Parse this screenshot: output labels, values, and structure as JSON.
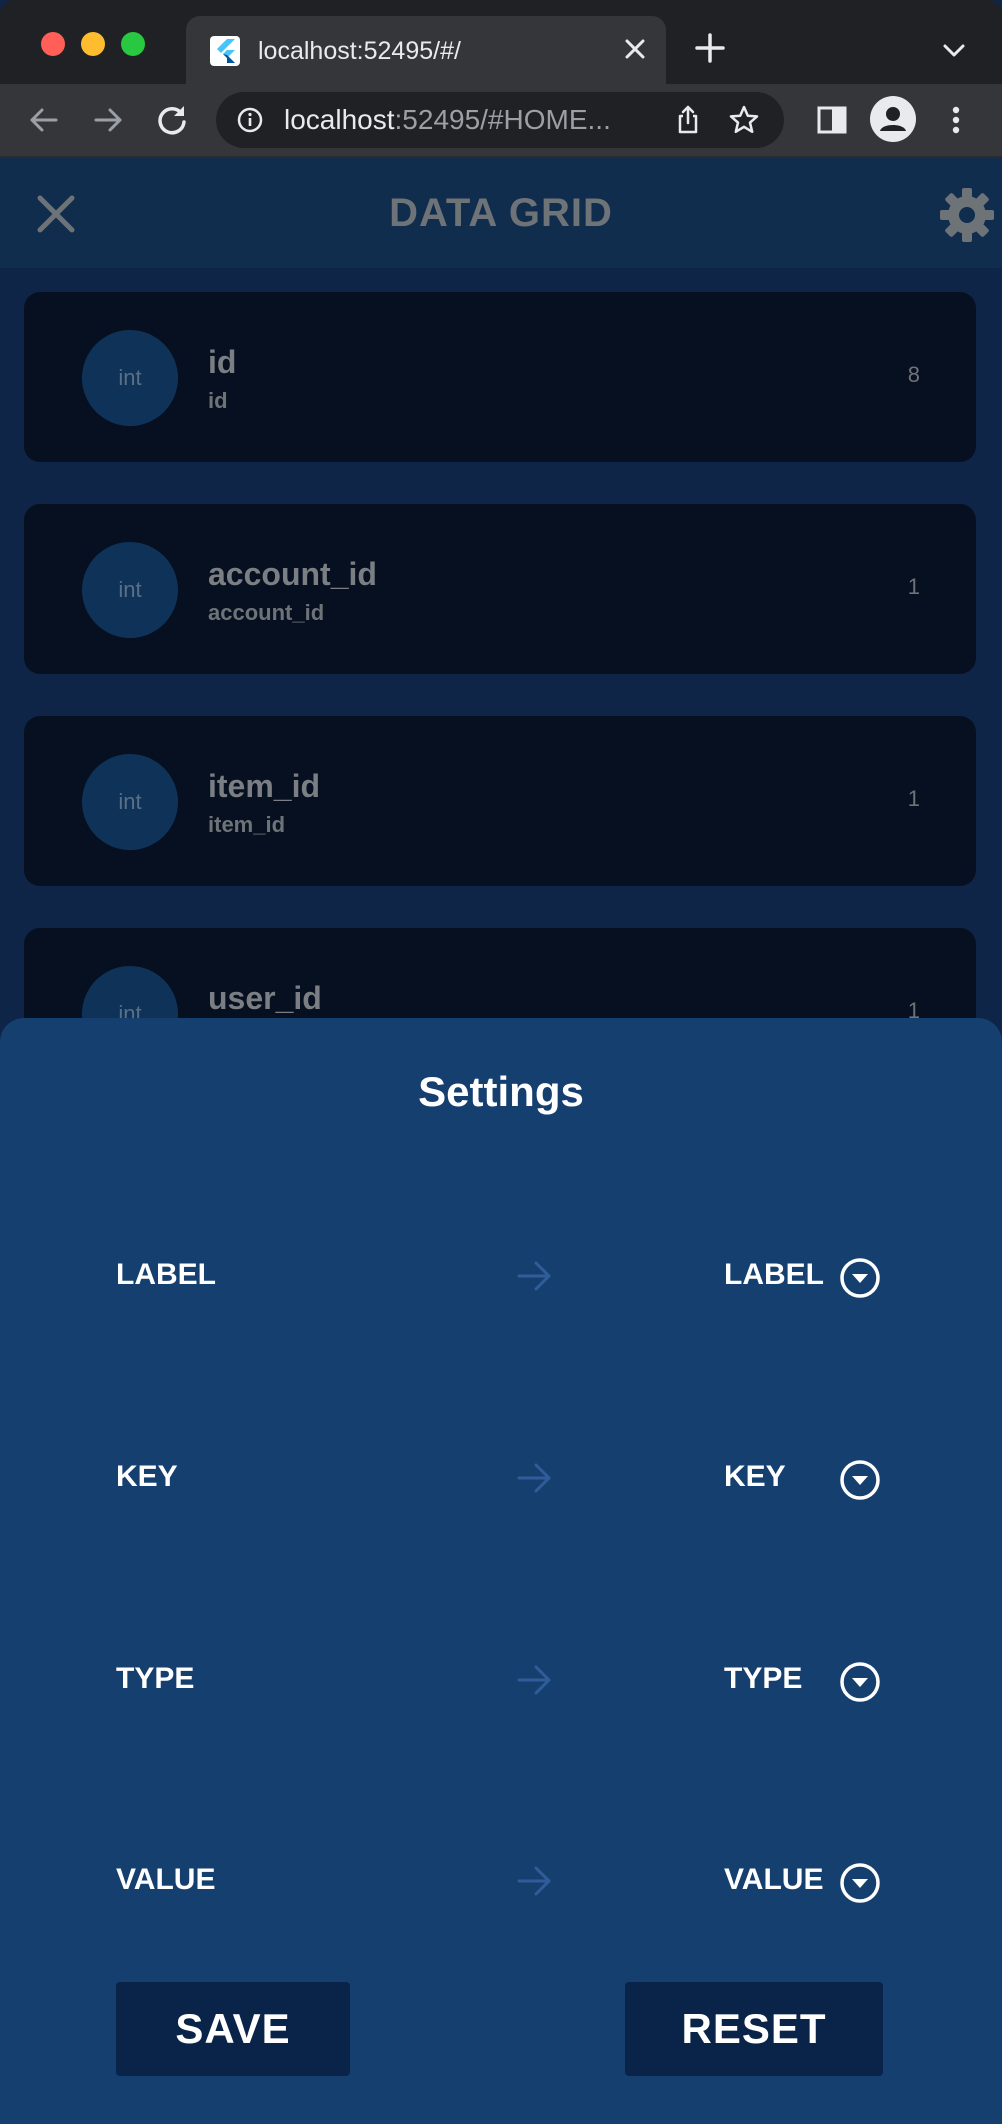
{
  "browser": {
    "tab_title": "localhost:52495/#/",
    "url_host": "localhost",
    "url_rest": ":52495/#HOME..."
  },
  "app": {
    "title": "DATA GRID"
  },
  "fields": [
    {
      "avatar": "int",
      "title": "id",
      "subtitle": "id",
      "count": "8"
    },
    {
      "avatar": "int",
      "title": "account_id",
      "subtitle": "account_id",
      "count": "1"
    },
    {
      "avatar": "int",
      "title": "item_id",
      "subtitle": "item_id",
      "count": "1"
    },
    {
      "avatar": "int",
      "title": "user_id",
      "subtitle": "",
      "count": "1"
    }
  ],
  "settings": {
    "title": "Settings",
    "mappings": [
      {
        "source": "LABEL",
        "target": "LABEL"
      },
      {
        "source": "KEY",
        "target": "KEY"
      },
      {
        "source": "TYPE",
        "target": "TYPE"
      },
      {
        "source": "VALUE",
        "target": "VALUE"
      }
    ],
    "save_label": "SAVE",
    "reset_label": "RESET"
  },
  "colors": {
    "accent_arrow": "#2e5d9a",
    "sheet_bg": "#153f6f",
    "button_bg": "#092448"
  }
}
